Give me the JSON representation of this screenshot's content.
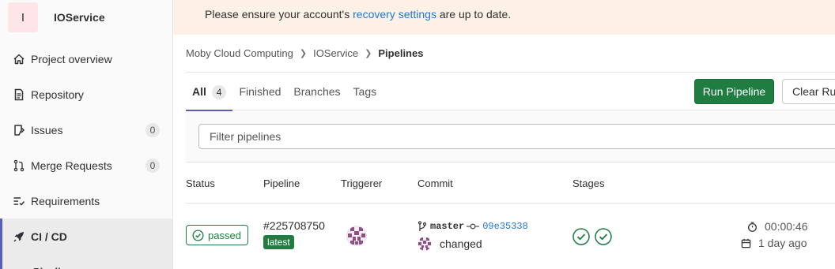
{
  "project": {
    "avatar_letter": "I",
    "name": "IOService"
  },
  "sidebar": {
    "items": [
      {
        "label": "Project overview",
        "icon": "home-icon"
      },
      {
        "label": "Repository",
        "icon": "document-icon"
      },
      {
        "label": "Issues",
        "icon": "issues-icon",
        "count": "0"
      },
      {
        "label": "Merge Requests",
        "icon": "merge-request-icon",
        "count": "0"
      },
      {
        "label": "Requirements",
        "icon": "requirements-icon"
      },
      {
        "label": "CI / CD",
        "icon": "rocket-icon",
        "active": true
      }
    ],
    "sub_item": "Pipelines"
  },
  "banner": {
    "prefix": "Please ensure your account's ",
    "link": "recovery settings",
    "suffix": " are up to date."
  },
  "breadcrumb": {
    "group": "Moby Cloud Computing",
    "project": "IOService",
    "current": "Pipelines"
  },
  "tabs": [
    {
      "label": "All",
      "count": "4",
      "active": true
    },
    {
      "label": "Finished"
    },
    {
      "label": "Branches"
    },
    {
      "label": "Tags"
    }
  ],
  "buttons": {
    "run": "Run Pipeline",
    "clear": "Clear Runner Caches"
  },
  "filter": {
    "placeholder": "Filter pipelines"
  },
  "table": {
    "headers": {
      "status": "Status",
      "pipeline": "Pipeline",
      "triggerer": "Triggerer",
      "commit": "Commit",
      "stages": "Stages"
    },
    "rows": [
      {
        "status": "passed",
        "pipeline_id": "#225708750",
        "badge": "latest",
        "branch": "master",
        "sha": "09e35338",
        "message": "changed",
        "duration": "00:00:46",
        "finished": "1 day ago"
      }
    ]
  },
  "colors": {
    "success": "#1f7d41",
    "link": "#1f78d1",
    "accent": "#5b5bb8",
    "banner_bg": "#fdf1e6"
  }
}
